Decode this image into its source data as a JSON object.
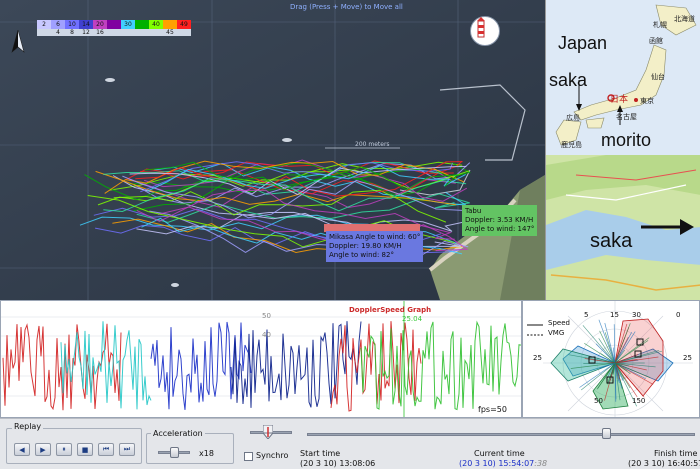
{
  "map": {
    "drag_hint": "Drag (Press + Move) to Move all",
    "color_scale_top": [
      "2",
      "6",
      "10",
      "14",
      "20",
      "",
      "30",
      "",
      "40",
      "",
      "49"
    ],
    "color_scale_bottom": [
      "",
      "4",
      "8",
      "12",
      "16",
      "",
      "",
      "",
      "",
      "45",
      ""
    ],
    "color_scale_colors": [
      "#c8c8ff",
      "#a0a0ff",
      "#7070ff",
      "#4040d0",
      "#c040c0",
      "#8000a0",
      "#40d0ff",
      "#00b000",
      "#80ff00",
      "#ffa000",
      "#ff2020"
    ],
    "meters_label": "200 meters",
    "tooltip_tabu": {
      "title": "Tabu",
      "doppler": "Doppler: 3.53 KM/H",
      "angle": "Angle to wind: 147°"
    },
    "tooltip_blue": {
      "line1": "Mikasa",
      "line1b": "Angle to wind: 60°",
      "doppler": "Doppler: 19.80 KM/H",
      "angle": "Angle to wind: 82°"
    },
    "north_icon": "north-arrow-icon",
    "lighthouse_icon": "lighthouse-icon"
  },
  "japan_map": {
    "title": "Japan",
    "label_saka": "saka",
    "label_morito": "morito",
    "label_nihon": "日本",
    "cities": [
      "札幌",
      "北海道",
      "函館",
      "仙台",
      "東京",
      "名古屋",
      "広島",
      "鹿児島"
    ]
  },
  "local_map": {
    "label_saka": "saka"
  },
  "graph": {
    "title": "DopplerSpeed Graph",
    "tick_50": "50",
    "tick_40": "40",
    "green_value": "25.04",
    "fps": "fps=50",
    "colors": {
      "red": "#d22020",
      "blue": "#1a2fc8",
      "cyan": "#22c6c6",
      "green": "#30c030",
      "navy": "#0a1f8a"
    }
  },
  "polar": {
    "legend_speed": "Speed",
    "legend_vmg": "VMG",
    "ring_labels": [
      "5",
      "15",
      "25",
      "30",
      "25",
      "50",
      "150",
      "0"
    ]
  },
  "controls": {
    "replay_label": "Replay",
    "acceleration_label": "Acceleration",
    "acceleration_value": "x18",
    "synchro_label": "Synchro",
    "start_time_label": "Start time",
    "start_time_value": "(20 3 10) 13:08:06",
    "current_time_label": "Current time",
    "current_time_value": "(20 3 10) 15:54:07",
    "current_time_suffix": ":38",
    "finish_time_label": "Finish time",
    "finish_time_value": "(20 3 10) 16:40:57",
    "buttons": [
      "◀",
      "▶",
      "⏸",
      "■",
      "⏮",
      "⏭"
    ]
  }
}
